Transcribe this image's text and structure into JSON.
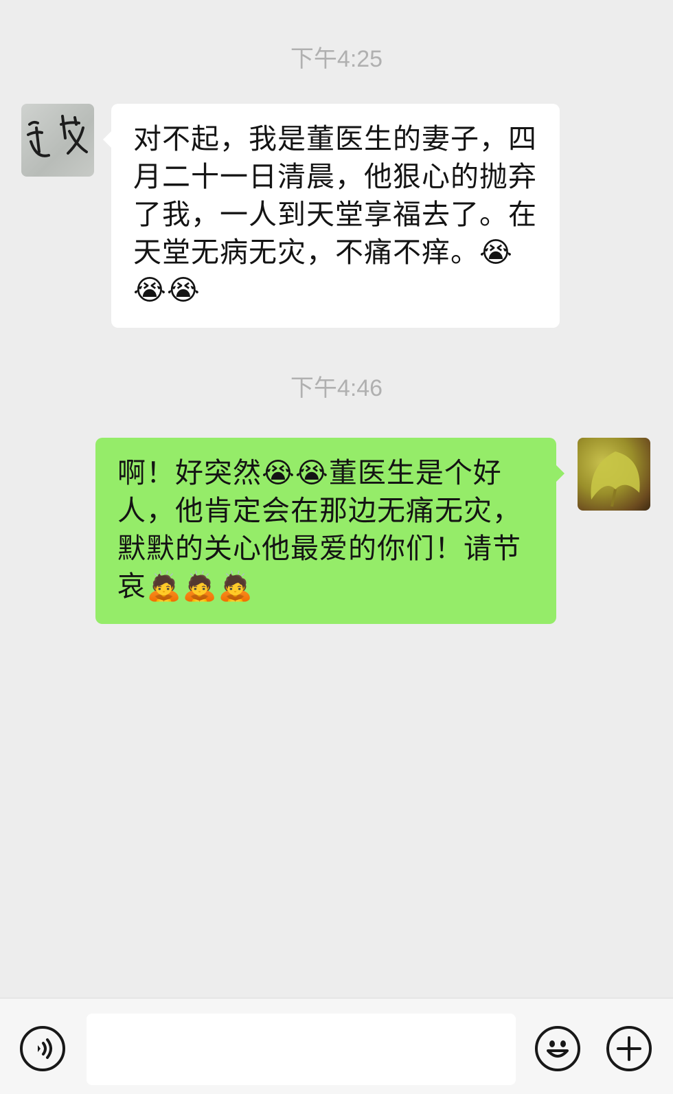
{
  "messages": [
    {
      "timestamp": "下午4:25",
      "side": "left",
      "avatar_icon": "calligraphy-avatar-icon",
      "text": "对不起，我是董医生的妻子，四月二十一日清晨，他狠心的抛弃了我，一人到天堂享福去了。在天堂无病无灾，不痛不痒。😭😭😭"
    },
    {
      "timestamp": "下午4:46",
      "side": "right",
      "avatar_icon": "ginkgo-leaf-avatar-icon",
      "text": "啊！好突然😭😭董医生是个好人，他肯定会在那边无痛无灾，默默的关心他最爱的你们！请节哀🙇🙇🙇"
    }
  ],
  "input_bar": {
    "voice_icon": "voice-icon",
    "text_value": "",
    "emoji_icon": "emoji-icon",
    "plus_icon": "plus-icon"
  },
  "colors": {
    "background": "#ededed",
    "incoming_bubble": "#ffffff",
    "outgoing_bubble": "#95ec69",
    "timestamp_text": "#b0b0b0"
  }
}
